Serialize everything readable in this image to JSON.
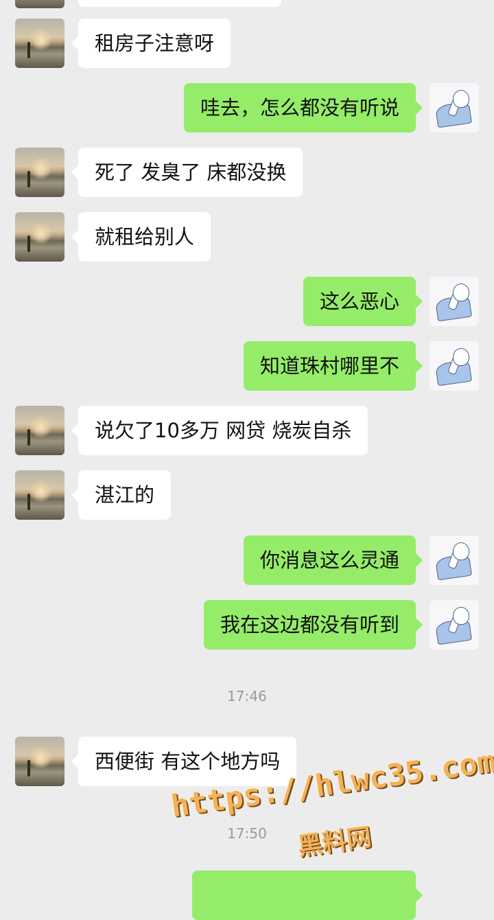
{
  "messages": [
    {
      "side": "in",
      "text": "租房子注意呀"
    },
    {
      "side": "out",
      "text": "哇去，怎么都没有听说"
    },
    {
      "side": "in",
      "text": "死了 发臭了 床都没换"
    },
    {
      "side": "in",
      "text": "就租给别人"
    },
    {
      "side": "out",
      "text": "这么恶心"
    },
    {
      "side": "out",
      "text": "知道珠村哪里不"
    },
    {
      "side": "in",
      "text": "说欠了10多万 网贷 烧炭自杀"
    },
    {
      "side": "in",
      "text": "湛江的"
    },
    {
      "side": "out",
      "text": "你消息这么灵通"
    },
    {
      "side": "out",
      "text": "我在这边都没有听到"
    },
    {
      "side": "in",
      "text": "西便街 有这个地方吗"
    }
  ],
  "timestamps": [
    "17:46",
    "17:50"
  ],
  "watermark": {
    "url": "https://hlwc35.com",
    "name": "黑料网"
  },
  "colors": {
    "background": "#ececec",
    "incoming_bubble": "#ffffff",
    "outgoing_bubble": "#95ec69"
  },
  "avatars": {
    "incoming": "sunset-beach-photo",
    "outgoing": "sketch-person-drawing"
  }
}
